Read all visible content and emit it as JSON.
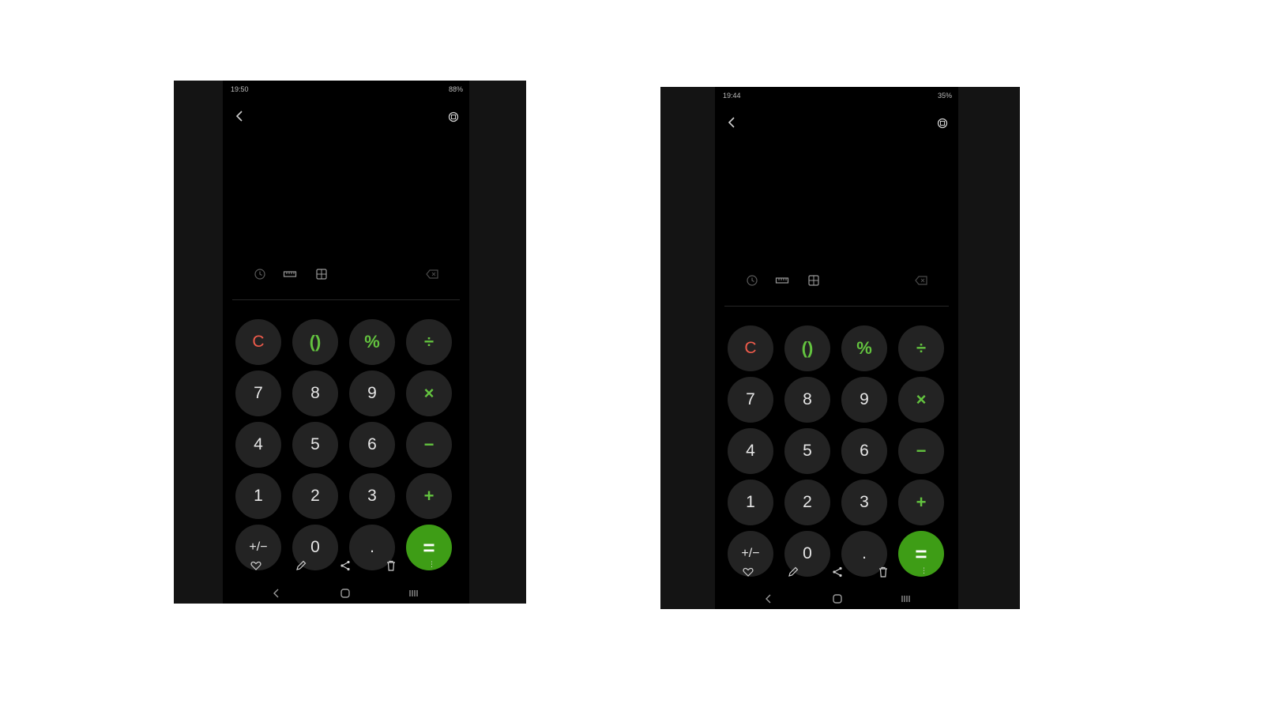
{
  "colors": {
    "background": "#141414",
    "screen": "#000000",
    "key": "#232323",
    "key_text": "#e6e6e6",
    "clear_red": "#ef5b4b",
    "operator_green": "#63c33f",
    "equals_green": "#3e9d16"
  },
  "screens": [
    {
      "status": {
        "time": "19:50",
        "system": "88%"
      },
      "keys": {
        "clear": "C",
        "parens": "()",
        "percent": "%",
        "divide": "÷",
        "seven": "7",
        "eight": "8",
        "nine": "9",
        "multiply": "×",
        "four": "4",
        "five": "5",
        "six": "6",
        "minus": "−",
        "one": "1",
        "two": "2",
        "three": "3",
        "plus": "+",
        "negate": "+/−",
        "zero": "0",
        "decimal": ".",
        "equals": "="
      }
    },
    {
      "status": {
        "time": "19:44",
        "system": "35%"
      },
      "keys": {
        "clear": "C",
        "parens": "()",
        "percent": "%",
        "divide": "÷",
        "seven": "7",
        "eight": "8",
        "nine": "9",
        "multiply": "×",
        "four": "4",
        "five": "5",
        "six": "6",
        "minus": "−",
        "one": "1",
        "two": "2",
        "three": "3",
        "plus": "+",
        "negate": "+/−",
        "zero": "0",
        "decimal": ".",
        "equals": "="
      }
    }
  ],
  "icons": {
    "back": "back-arrow-icon",
    "rotate": "rotate-screen-icon",
    "history": "history-clock-icon",
    "ruler": "unit-converter-ruler-icon",
    "scientific": "scientific-mode-icon",
    "backspace": "backspace-icon",
    "favorite": "heart-icon",
    "edit": "pencil-icon",
    "share": "share-icon",
    "delete": "trash-icon",
    "nav_back": "nav-back-icon",
    "nav_home": "nav-home-icon",
    "nav_recent": "nav-recent-apps-icon"
  }
}
